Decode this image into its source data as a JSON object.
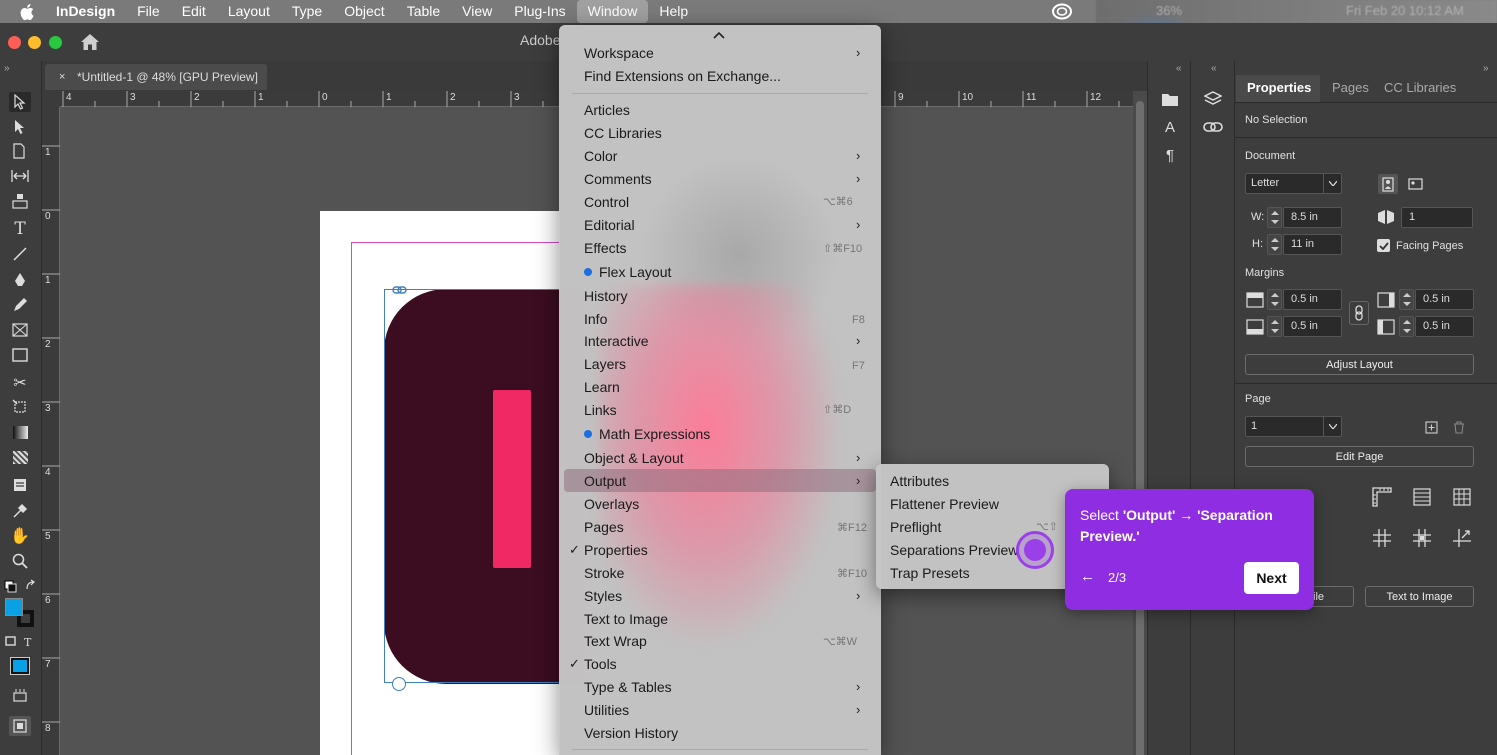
{
  "menubar": {
    "app_name": "InDesign",
    "items": [
      "File",
      "Edit",
      "Layout",
      "Type",
      "Object",
      "Table",
      "View",
      "Plug-Ins",
      "Window",
      "Help"
    ],
    "status": {
      "battery": "36%",
      "datetime": "Fri Feb 20  10:12 AM"
    }
  },
  "window": {
    "title": "Adobe"
  },
  "document_tab": {
    "close": "×",
    "title": "*Untitled-1 @ 48% [GPU Preview]"
  },
  "rulers": {
    "h_ticks": [
      "4",
      "3",
      "2",
      "1",
      "0",
      "1",
      "2",
      "3",
      "9",
      "10",
      "11",
      "12"
    ],
    "v_ticks": [
      "1",
      "0",
      "1",
      "2",
      "3",
      "4",
      "5",
      "6",
      "7",
      "8"
    ]
  },
  "window_menu": {
    "items": [
      {
        "label": "Workspace",
        "submenu": true
      },
      {
        "label": "Find Extensions on Exchange..."
      },
      {
        "label": "Articles"
      },
      {
        "label": "CC Libraries"
      },
      {
        "label": "Color",
        "submenu": true
      },
      {
        "label": "Comments",
        "submenu": true
      },
      {
        "label": "Control",
        "shortcut": "⌥⌘6"
      },
      {
        "label": "Editorial",
        "submenu": true
      },
      {
        "label": "Effects",
        "shortcut": "⇧⌘F10"
      },
      {
        "label": "Flex Layout",
        "new": true
      },
      {
        "label": "History"
      },
      {
        "label": "Info",
        "shortcut": "F8"
      },
      {
        "label": "Interactive",
        "submenu": true
      },
      {
        "label": "Layers",
        "shortcut": "F7"
      },
      {
        "label": "Learn"
      },
      {
        "label": "Links",
        "shortcut": "⇧⌘D"
      },
      {
        "label": "Math Expressions",
        "new": true
      },
      {
        "label": "Object & Layout",
        "submenu": true
      },
      {
        "label": "Output",
        "submenu": true,
        "highlighted": true
      },
      {
        "label": "Overlays"
      },
      {
        "label": "Pages",
        "shortcut": "⌘F12"
      },
      {
        "label": "Properties",
        "checked": true
      },
      {
        "label": "Stroke",
        "shortcut": "⌘F10"
      },
      {
        "label": "Styles",
        "submenu": true
      },
      {
        "label": "Text to Image"
      },
      {
        "label": "Text Wrap",
        "shortcut": "⌥⌘W"
      },
      {
        "label": "Tools",
        "checked": true
      },
      {
        "label": "Type & Tables",
        "submenu": true
      },
      {
        "label": "Utilities",
        "submenu": true
      },
      {
        "label": "Version History"
      }
    ]
  },
  "output_submenu": {
    "items": [
      "Attributes",
      "Flattener Preview",
      "Preflight",
      "Separations Preview",
      "Trap Presets"
    ],
    "preflight_shortcut": "⌥⇧"
  },
  "callout": {
    "prefix": "Select ",
    "highlight": "'Output' → 'Separation Preview.'",
    "progress": "2/3",
    "back": "←",
    "next_label": "Next"
  },
  "properties_panel": {
    "tabs": [
      "Properties",
      "Pages",
      "CC Libraries"
    ],
    "selection": "No Selection",
    "document_heading": "Document",
    "page_size": "Letter",
    "width_label": "W:",
    "width": "8.5 in",
    "height_label": "H:",
    "height": "11 in",
    "pages_count": "1",
    "facing_pages": "Facing Pages",
    "margins_heading": "Margins",
    "margin_top": "0.5 in",
    "margin_bottom": "0.5 in",
    "margin_left": "0.5 in",
    "margin_right": "0.5 in",
    "adjust_layout": "Adjust Layout",
    "page_heading": "Page",
    "page_value": "1",
    "edit_page": "Edit Page",
    "partial_button": "ile",
    "text_to_image": "Text to Image"
  },
  "colors": {
    "menubar": "#7a7a7a",
    "callout": "#8e2de2",
    "logo_bg": "#3c0d20",
    "logo_accent": "#f02864",
    "fill_swatch": "#0aa0e6"
  }
}
